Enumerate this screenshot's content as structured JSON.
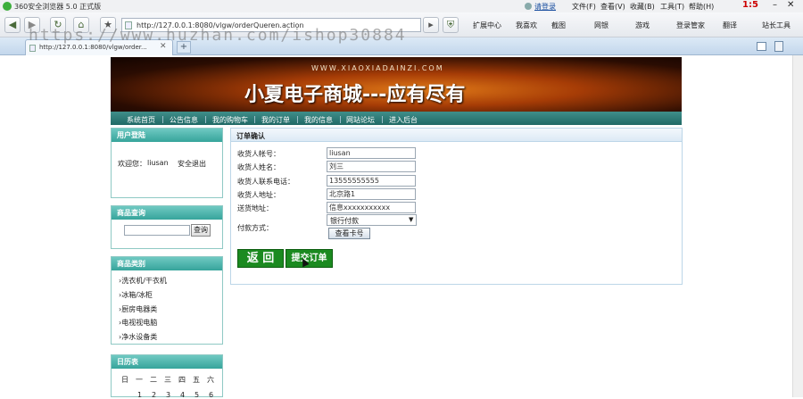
{
  "browser": {
    "app_title": "360安全浏览器 5.0 正式版",
    "login_link": "请登录",
    "menus": [
      "文件(F)",
      "查看(V)",
      "收藏(B)",
      "工具(T)",
      "帮助(H)"
    ],
    "clock": "1:5",
    "address": "http://127.0.0.1:8080/vlgw/orderQueren.action",
    "toolbar_items": [
      "扩展中心",
      "我喜欢",
      "截图",
      "网银",
      "游戏",
      "登录管家",
      "翻译",
      "站长工具"
    ],
    "tab_title": "http://127.0.0.1:8080/vlgw/order...",
    "watermark": "https://www.huzhan.com/ishop30884"
  },
  "site": {
    "banner_url": "WWW.XIAOXIADAINZI.COM",
    "banner_title": "小夏电子商城---应有尽有",
    "nav": [
      "系统首页",
      "公告信息",
      "我的购物车",
      "我的订单",
      "我的信息",
      "网站论坛",
      "进入后台"
    ]
  },
  "sidebar": {
    "login_title": "用户登陆",
    "welcome": "欢迎您：",
    "username": "liusan",
    "logout": "安全退出",
    "search_title": "商品查询",
    "search_value": "",
    "search_button": "查询",
    "category_title": "商品类别",
    "categories": [
      "洗衣机/干衣机",
      "冰箱/冰柜",
      "厨房电器类",
      "电视视电脑",
      "净水设备类"
    ],
    "calendar_title": "日历表",
    "weekdays": [
      "日",
      "一",
      "二",
      "三",
      "四",
      "五",
      "六"
    ],
    "first_row": [
      "1",
      "2",
      "3",
      "4",
      "5",
      "6"
    ]
  },
  "order": {
    "title": "订单确认",
    "fields": [
      {
        "label": "收货人帐号：",
        "value": "liusan"
      },
      {
        "label": "收货人姓名：",
        "value": "刘三"
      },
      {
        "label": "收货人联系电话：",
        "value": "13555555555"
      },
      {
        "label": "收货人地址：",
        "value": "北京路1"
      },
      {
        "label": "送货地址：",
        "value": "信息xxxxxxxxxxx"
      }
    ],
    "payment_label": "付款方式：",
    "payment_selected": "银行付款",
    "view_card_button": "查看卡号",
    "back_button": "返 回",
    "submit_button": "提交订单"
  }
}
